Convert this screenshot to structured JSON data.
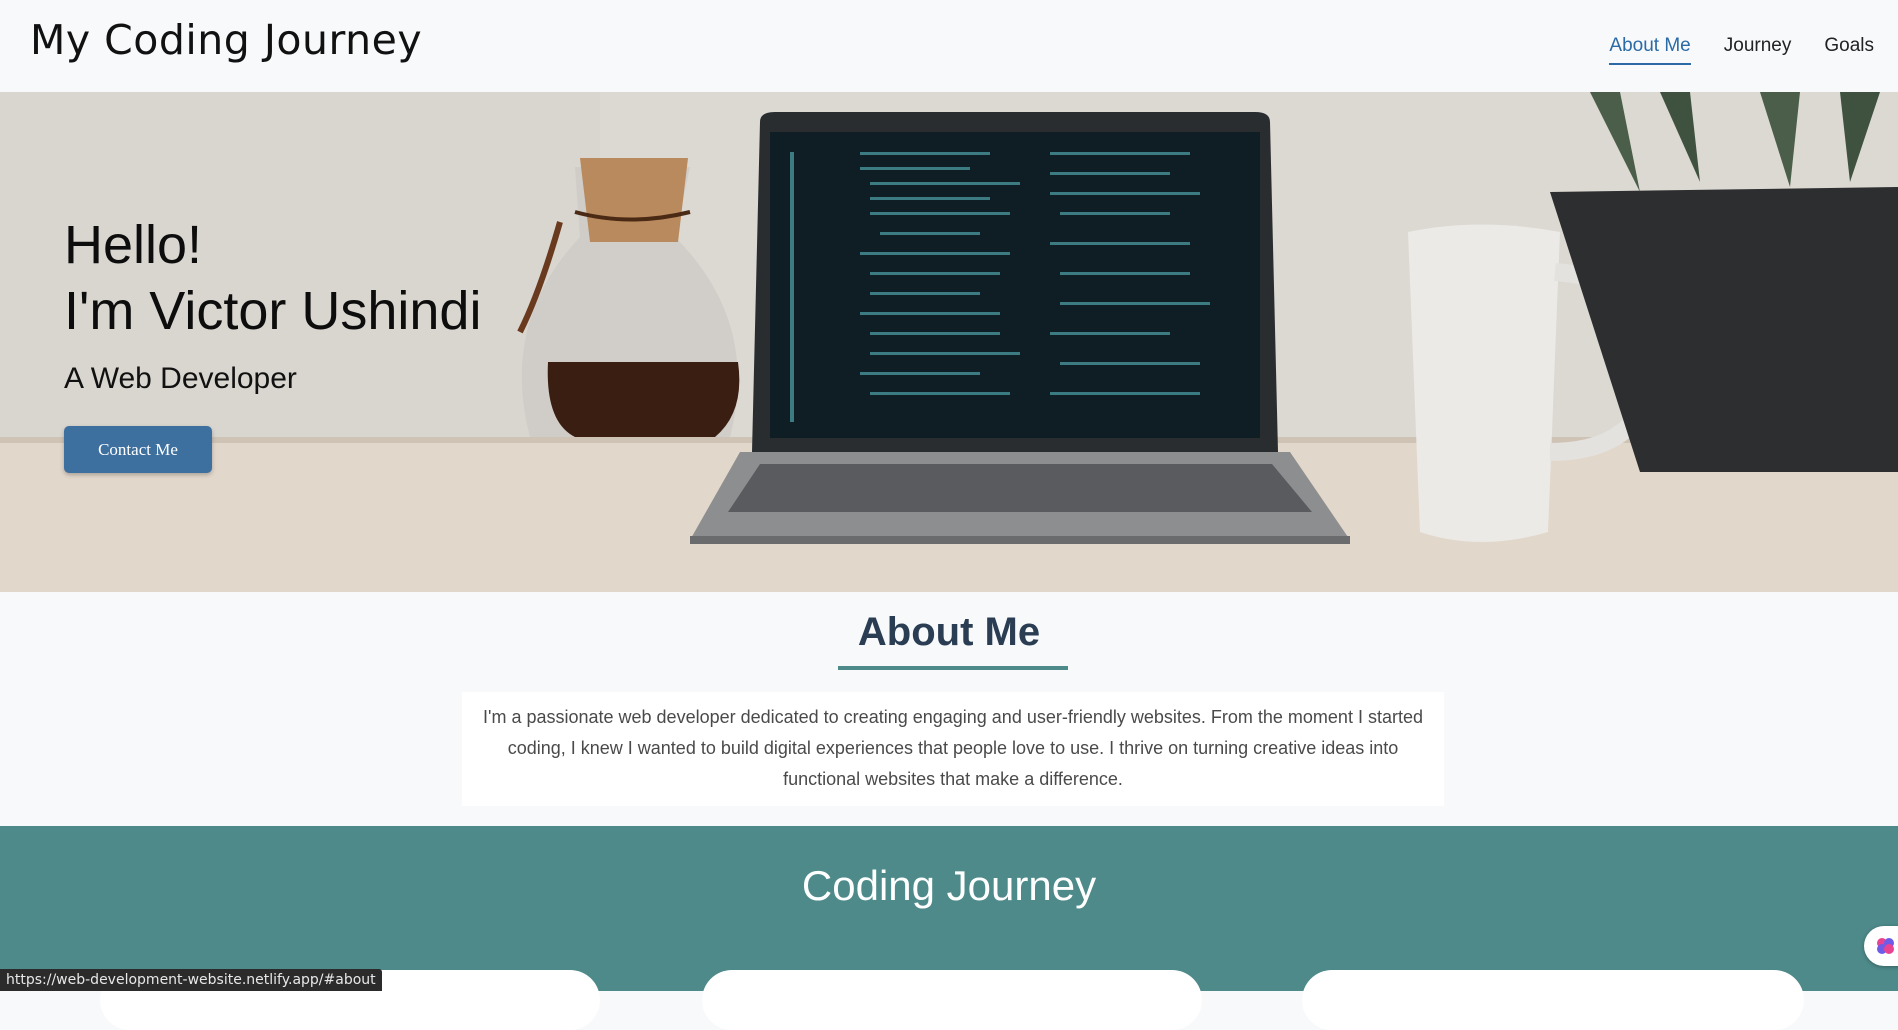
{
  "header": {
    "logo": "My Coding Journey",
    "nav": [
      {
        "label": "About Me",
        "active": true
      },
      {
        "label": "Journey",
        "active": false
      },
      {
        "label": "Goals",
        "active": false
      }
    ]
  },
  "hero": {
    "greeting": "Hello!",
    "name": "I'm Victor Ushindi",
    "role": "A Web Developer",
    "contact_button": "Contact Me"
  },
  "about": {
    "title": "About Me",
    "text": "I'm a passionate web developer dedicated to creating engaging and user-friendly websites. From the moment I started coding, I knew I wanted to build digital experiences that people love to use. I thrive on turning creative ideas into functional websites that make a difference."
  },
  "journey": {
    "title": "Coding Journey"
  },
  "status": {
    "url": "https://web-development-website.netlify.app/#about"
  },
  "colors": {
    "accent": "#2c6aa6",
    "teal": "#4e8a8a",
    "button": "#3d6f9f",
    "heading": "#2a3d52"
  }
}
